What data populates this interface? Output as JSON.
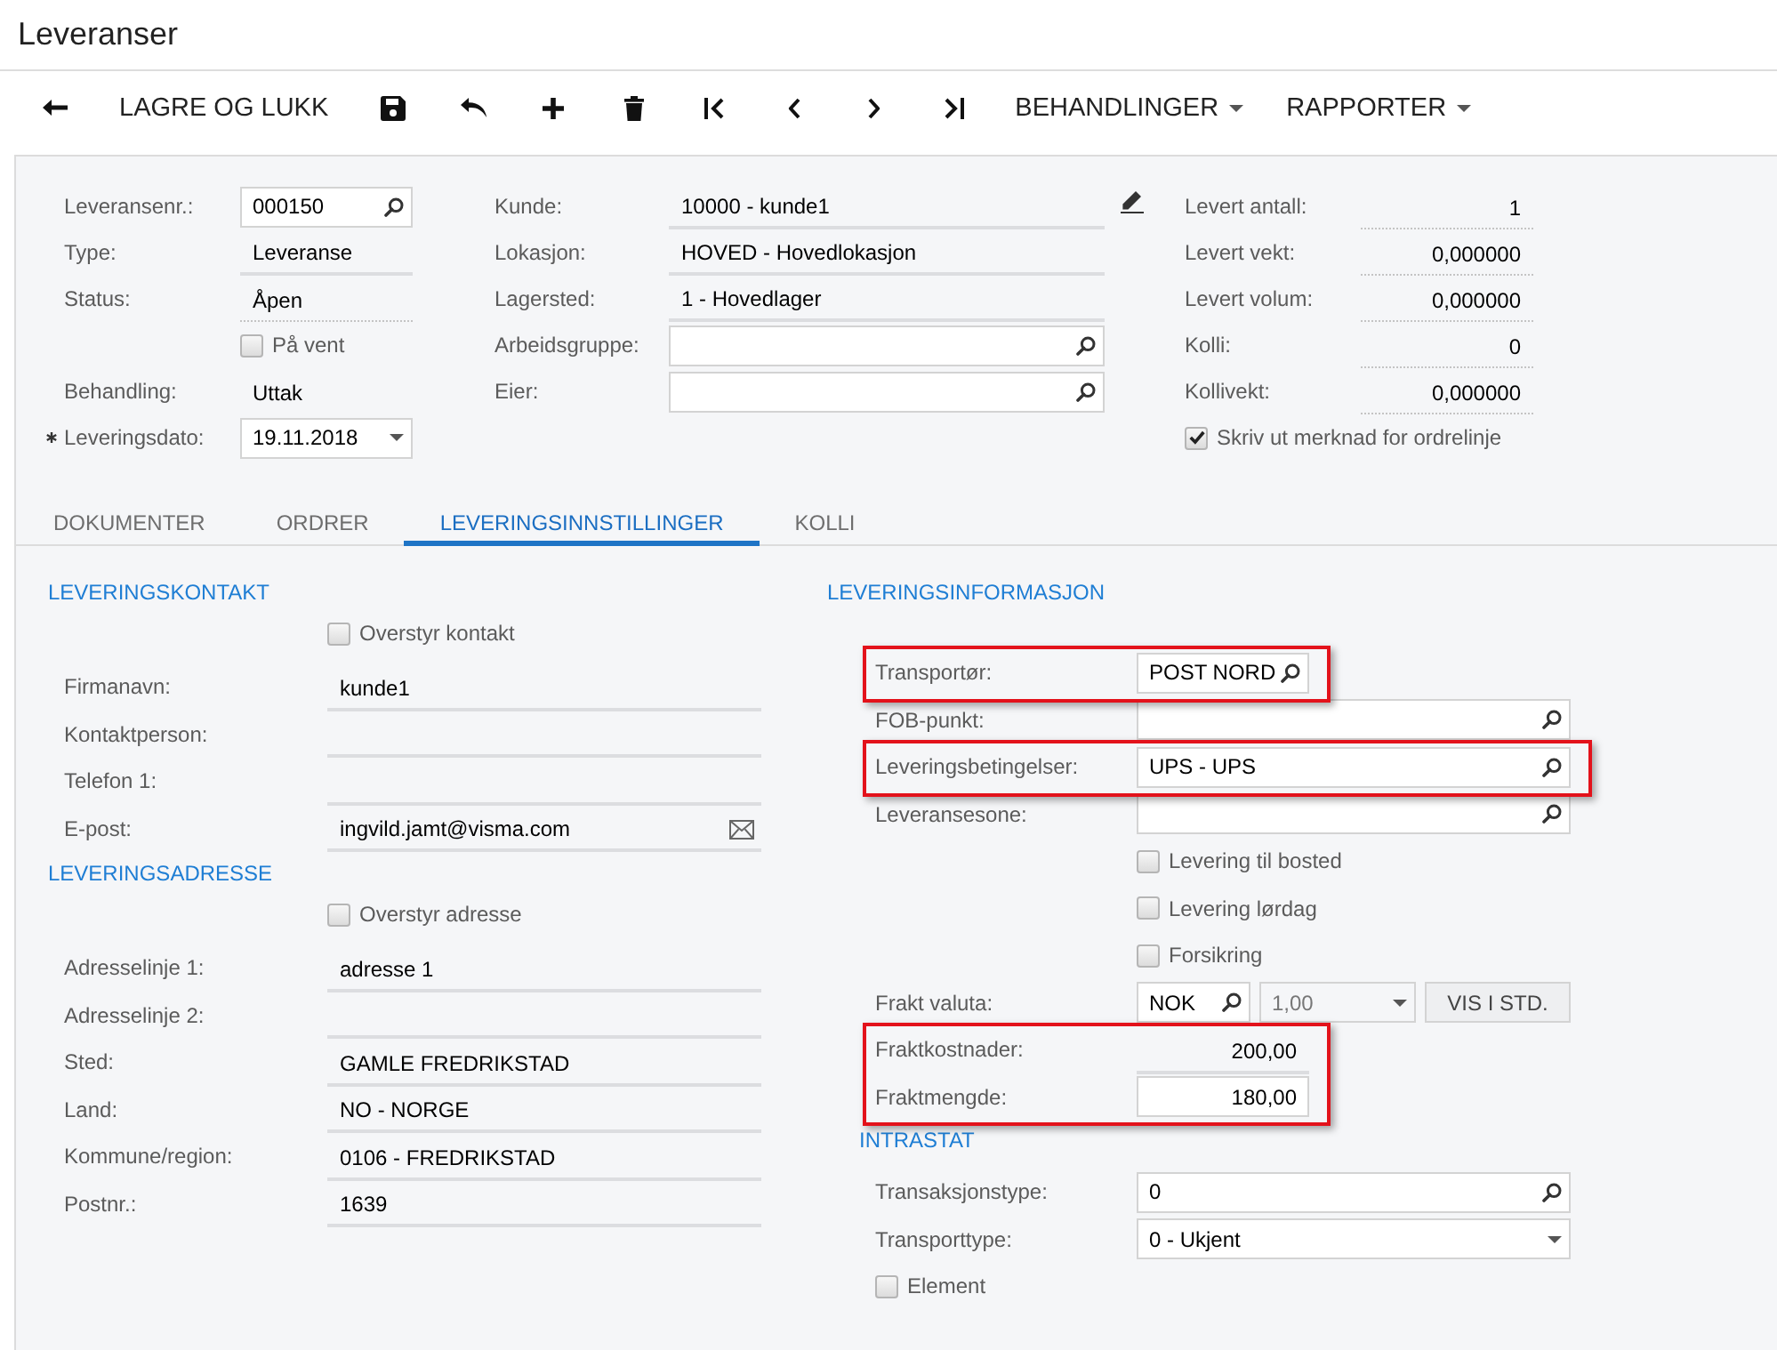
{
  "window": {
    "title": "Leveranser"
  },
  "toolbar": [
    {
      "kind": "back"
    },
    {
      "kind": "text",
      "label": "LAGRE OG LUKK"
    },
    {
      "kind": "save"
    },
    {
      "kind": "undo"
    },
    {
      "kind": "add"
    },
    {
      "kind": "delete"
    },
    {
      "kind": "first"
    },
    {
      "kind": "previous"
    },
    {
      "kind": "next"
    },
    {
      "kind": "last"
    },
    {
      "kind": "menu",
      "label": "BEHANDLINGER"
    },
    {
      "kind": "menu",
      "label": "RAPPORTER"
    }
  ],
  "header": {
    "columns": [
      [
        {
          "kind": "lookup",
          "label": "Leveransenr.:",
          "value": "000150",
          "required": false
        },
        {
          "kind": "display",
          "label": "Type:",
          "value": "Leveranse",
          "required": false
        },
        {
          "kind": "status",
          "label": "Status:",
          "value": "Åpen",
          "required": false
        },
        {
          "kind": "checkbox",
          "label": "På vent",
          "checked": false,
          "required": false
        },
        {
          "kind": "plain",
          "label": "Behandling:",
          "value": "Uttak",
          "required": false
        },
        {
          "kind": "date",
          "label": "Leveringsdato:",
          "value": "19.11.2018",
          "required": true
        }
      ],
      [
        {
          "kind": "editable",
          "label": "Kunde:",
          "value": "10000 - kunde1"
        },
        {
          "kind": "display",
          "label": "Lokasjon:",
          "value": "HOVED - Hovedlokasjon"
        },
        {
          "kind": "display",
          "label": "Lagersted:",
          "value": "1 - Hovedlager"
        },
        {
          "kind": "lookup",
          "label": "Arbeidsgruppe:"
        },
        {
          "kind": "lookup",
          "label": "Eier:"
        }
      ],
      [
        {
          "kind": "number",
          "label": "Levert antall:",
          "value": "1"
        },
        {
          "kind": "number",
          "label": "Levert vekt:",
          "value": "0,000000"
        },
        {
          "kind": "number",
          "label": "Levert volum:",
          "value": "0,000000"
        },
        {
          "kind": "number",
          "label": "Kolli:",
          "value": "0"
        },
        {
          "kind": "number",
          "label": "Kollivekt:",
          "value": "0,000000"
        },
        {
          "kind": "standalone_checkbox",
          "label": "Skriv ut merknad for ordrelinje",
          "checked": true
        }
      ]
    ]
  },
  "tabs": [
    {
      "label": "DOKUMENTER",
      "selected": false
    },
    {
      "label": "ORDRER",
      "selected": false
    },
    {
      "label": "LEVERINGSINNSTILLINGER",
      "selected": true
    },
    {
      "label": "KOLLI",
      "selected": false
    }
  ],
  "left_column": [
    {
      "heading": "LEVERINGSKONTAKT",
      "rows": [
        {
          "kind": "checkbox",
          "label": "Overstyr kontakt",
          "checked": false
        },
        {
          "kind": "display",
          "label": "Firmanavn:",
          "value": "kunde1"
        },
        {
          "kind": "display",
          "label": "Kontaktperson:"
        },
        {
          "kind": "display",
          "label": "Telefon 1:"
        },
        {
          "kind": "email",
          "label": "E-post:",
          "value": "ingvild.jamt@visma.com"
        }
      ]
    },
    {
      "heading": "LEVERINGSADRESSE",
      "rows": [
        {
          "kind": "checkbox",
          "label": "Overstyr adresse",
          "checked": false
        },
        {
          "kind": "display",
          "label": "Adresselinje 1:",
          "value": "adresse 1"
        },
        {
          "kind": "display",
          "label": "Adresselinje 2:"
        },
        {
          "kind": "display",
          "label": "Sted:",
          "value": "GAMLE FREDRIKSTAD"
        },
        {
          "kind": "display",
          "label": "Land:",
          "value": "NO - NORGE"
        },
        {
          "kind": "display",
          "label": "Kommune/region:",
          "value": "0106 - FREDRIKSTAD"
        },
        {
          "kind": "display",
          "label": "Postnr.:",
          "value": "1639"
        }
      ]
    }
  ],
  "right_column": {
    "heading": "LEVERINGSINFORMASJON",
    "rows": [
      {
        "kind": "short_lookup",
        "label": "Transportør:",
        "value": "POST NORD",
        "highlighted": true
      },
      {
        "kind": "lookup",
        "label": "FOB-punkt:",
        "highlighted": false
      },
      {
        "kind": "lookup",
        "label": "Leveringsbetingelser:",
        "value": "UPS - UPS",
        "highlighted": true
      },
      {
        "kind": "lookup",
        "label": "Leveransesone:",
        "highlighted": false
      },
      {
        "kind": "checkbox",
        "label": "Levering til bosted",
        "checked": false,
        "highlighted": false
      },
      {
        "kind": "checkbox",
        "label": "Levering lørdag",
        "checked": false,
        "highlighted": false
      },
      {
        "kind": "checkbox",
        "label": "Forsikring",
        "checked": false,
        "highlighted": false
      },
      {
        "kind": "currency",
        "label": "Frakt valuta:",
        "value": "NOK",
        "rate": "1,00",
        "rate_disabled": true,
        "button": "VIS I STD.",
        "highlighted": false
      },
      {
        "kind": "amount",
        "label": "Fraktkostnader:",
        "value": "200,00",
        "highlighted": true
      },
      {
        "kind": "amount_input",
        "label": "Fraktmengde:",
        "value": "180,00",
        "highlighted": true
      }
    ],
    "sections": [
      {
        "heading": "INTRASTAT",
        "rows": [
          {
            "kind": "lookup",
            "label": "Transaksjonstype:",
            "value": "0"
          },
          {
            "kind": "select",
            "label": "Transporttype:",
            "value": "0 - Ukjent"
          },
          {
            "kind": "standalone_checkbox",
            "label": "Element",
            "checked": false
          }
        ]
      }
    ]
  }
}
